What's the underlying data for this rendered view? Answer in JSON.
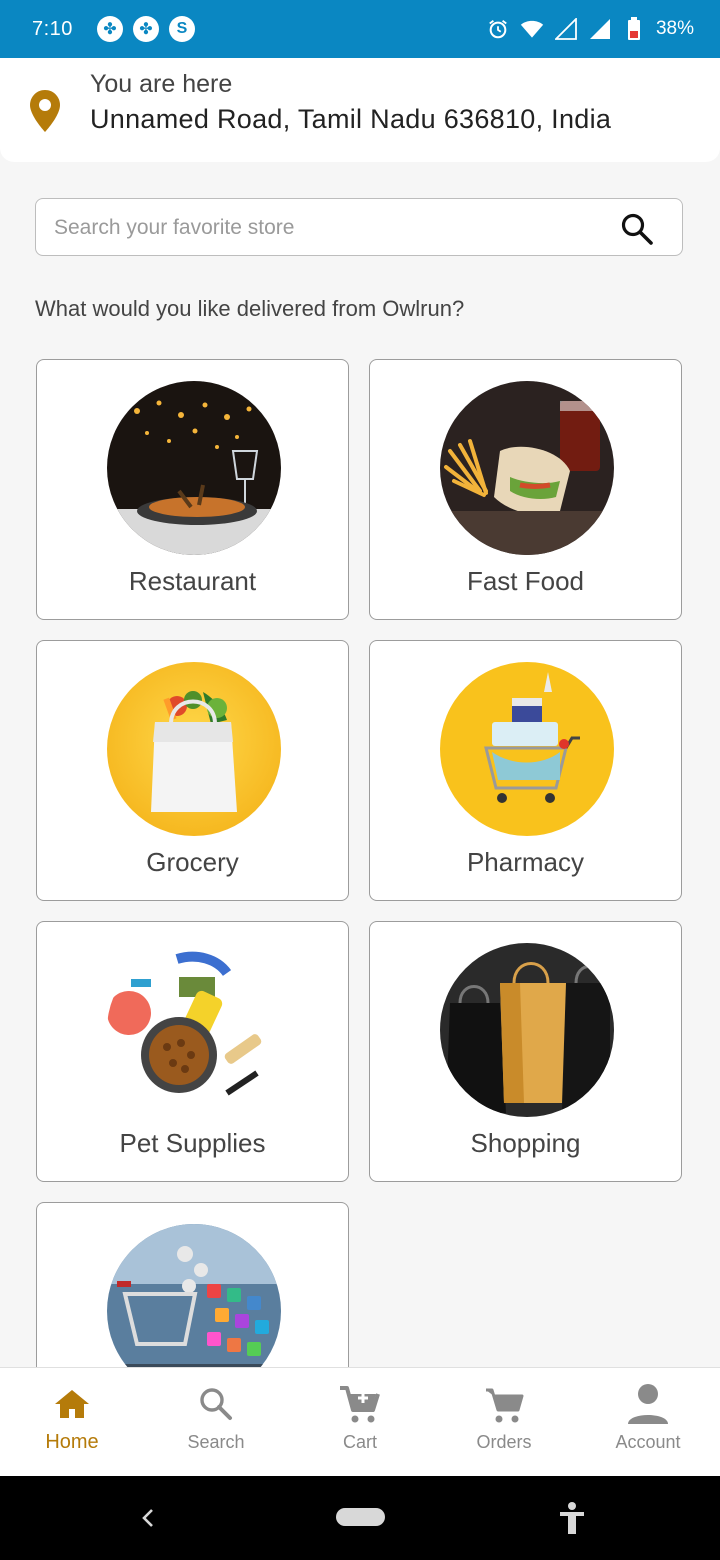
{
  "status_bar": {
    "time": "7:10",
    "battery": "38%",
    "background": "#0a87c2"
  },
  "location": {
    "caption": "You are here",
    "address": "Unnamed Road, Tamil Nadu 636810, India",
    "pin_color": "#b57b0a"
  },
  "search": {
    "placeholder": "Search your favorite store"
  },
  "prompt": "What would you like delivered from Owlrun?",
  "categories": [
    {
      "label": "Restaurant"
    },
    {
      "label": "Fast Food"
    },
    {
      "label": "Grocery"
    },
    {
      "label": "Pharmacy"
    },
    {
      "label": "Pet Supplies"
    },
    {
      "label": "Shopping"
    },
    {
      "label": ""
    }
  ],
  "bottom_nav": {
    "items": [
      {
        "label": "Home",
        "icon": "home-icon",
        "active": true
      },
      {
        "label": "Search",
        "icon": "search-icon"
      },
      {
        "label": "Cart",
        "icon": "add-cart-icon"
      },
      {
        "label": "Orders",
        "icon": "cart-icon"
      },
      {
        "label": "Account",
        "icon": "account-icon"
      }
    ],
    "active_color": "#b57b0a"
  }
}
